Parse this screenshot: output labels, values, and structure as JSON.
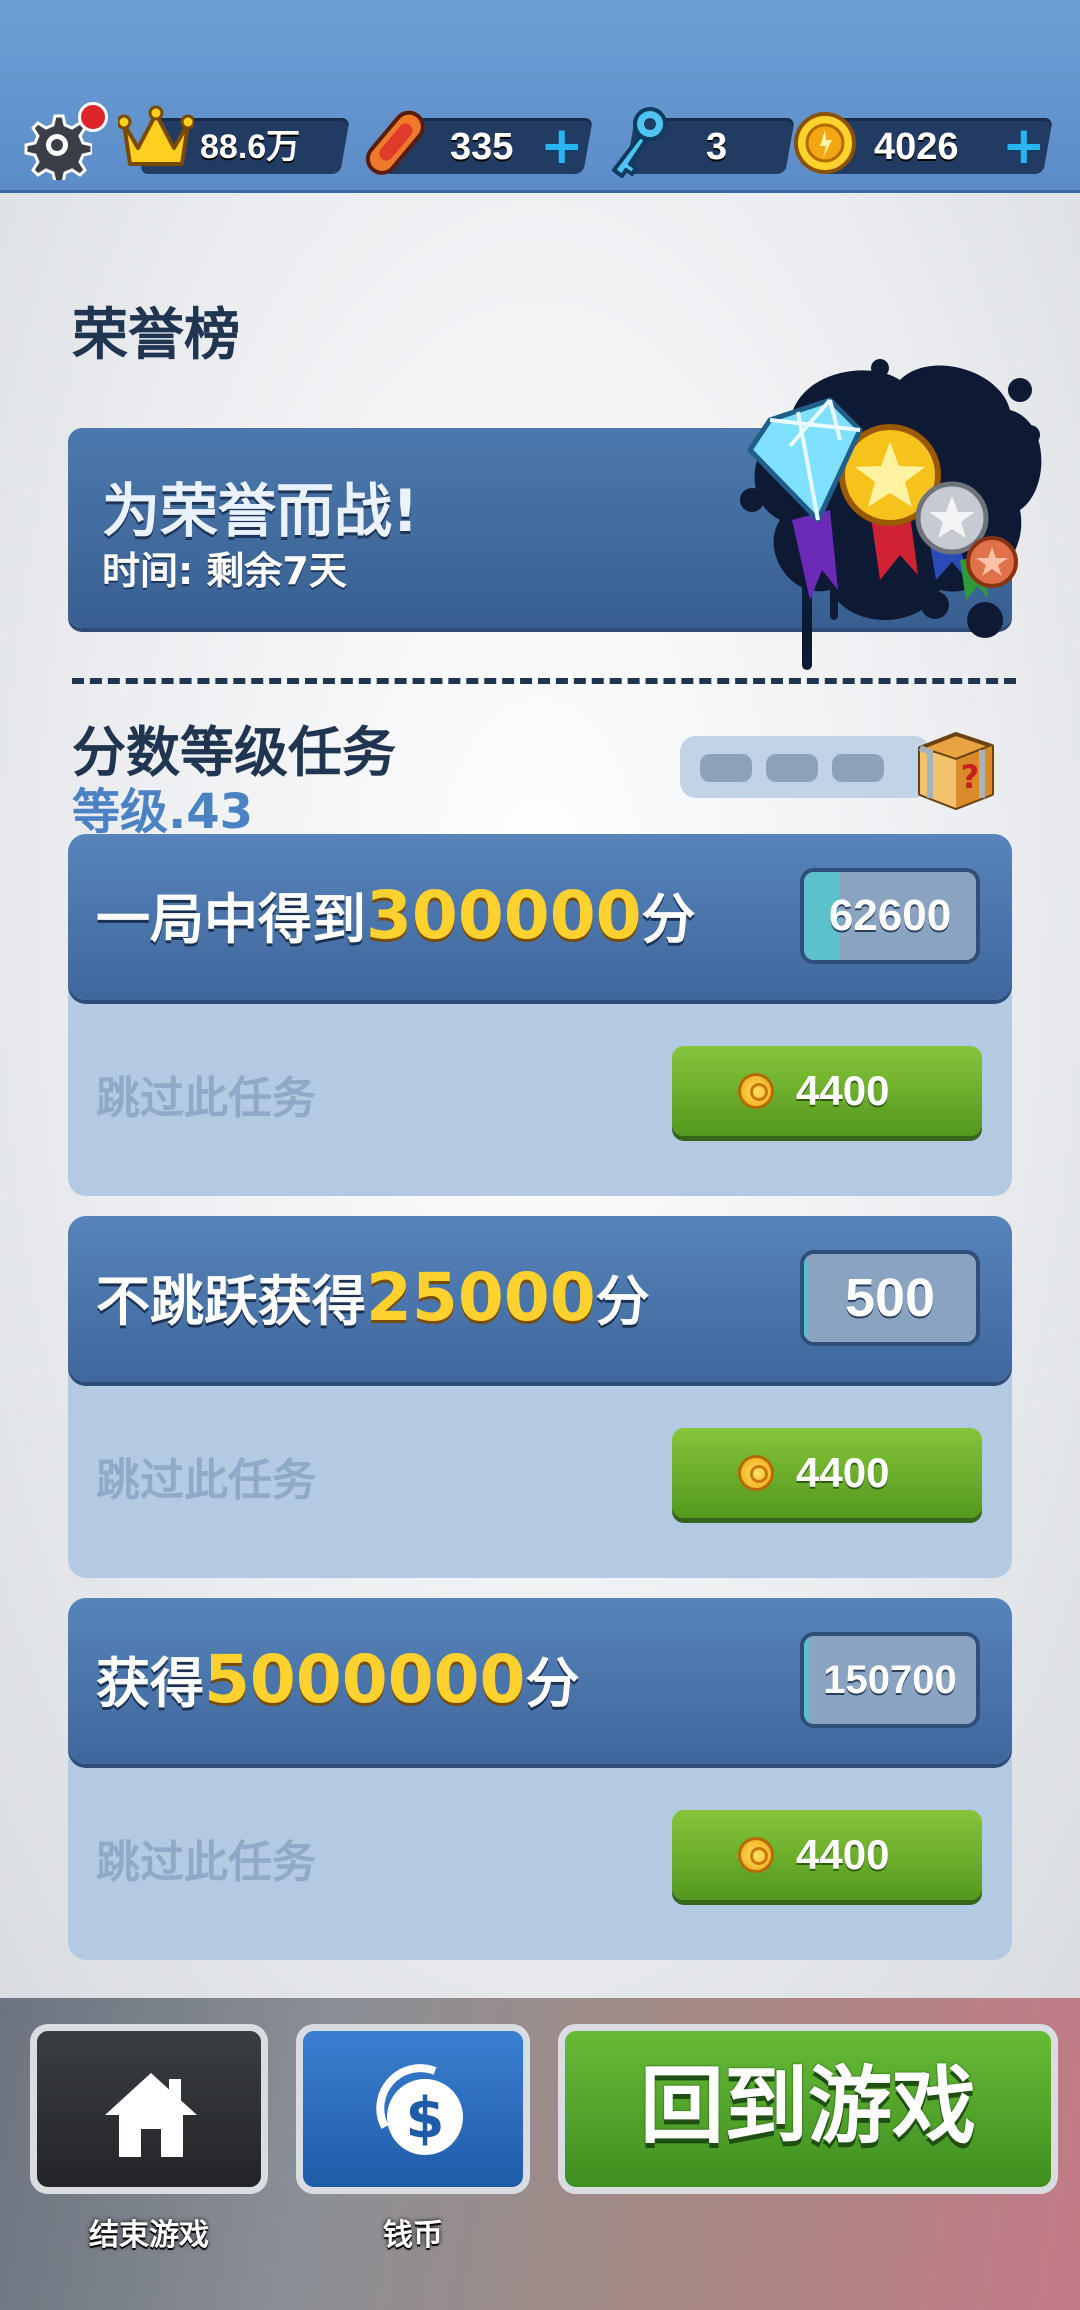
{
  "topbar": {
    "settings_has_notification": true,
    "stats": [
      {
        "icon": "crown-icon",
        "value": "88.6万",
        "has_plus": false
      },
      {
        "icon": "hoverboard-icon",
        "value": "335",
        "has_plus": true
      },
      {
        "icon": "key-icon",
        "value": "3",
        "has_plus": false
      },
      {
        "icon": "coin-icon",
        "value": "4026",
        "has_plus": true
      }
    ]
  },
  "honor": {
    "section_title": "荣誉榜",
    "banner_title": "为荣誉而战!",
    "banner_subtitle": "时间: 剩余7天"
  },
  "missions_section": {
    "title": "分数等级任务",
    "level": "等级.43",
    "reward_progress_filled": 0,
    "reward_progress_total": 3,
    "reward_icon": "mystery-box-icon"
  },
  "missions": [
    {
      "prefix": "一局中得到",
      "target": "300000",
      "suffix": "分",
      "progress": "62600",
      "progress_fraction": 0.21,
      "skip_label": "跳过此任务",
      "skip_price": "4400"
    },
    {
      "prefix": "不跳跃获得",
      "target": "25000",
      "suffix": "分",
      "progress": "500",
      "progress_fraction": 0.02,
      "skip_label": "跳过此任务",
      "skip_price": "4400"
    },
    {
      "prefix": "获得",
      "target": "5000000",
      "suffix": "分",
      "progress": "150700",
      "progress_fraction": 0.03,
      "skip_label": "跳过此任务",
      "skip_price": "4400"
    }
  ],
  "bottom": {
    "end_game_label": "结束游戏",
    "coins_label": "钱币",
    "play_label": "回到游戏"
  },
  "colors": {
    "topbar": "#6e9fd6",
    "card_header": "#4c79ad",
    "highlight_yellow": "#ffd12e",
    "skip_button_green": "#6fb12c",
    "play_button_green": "#54a62a"
  }
}
